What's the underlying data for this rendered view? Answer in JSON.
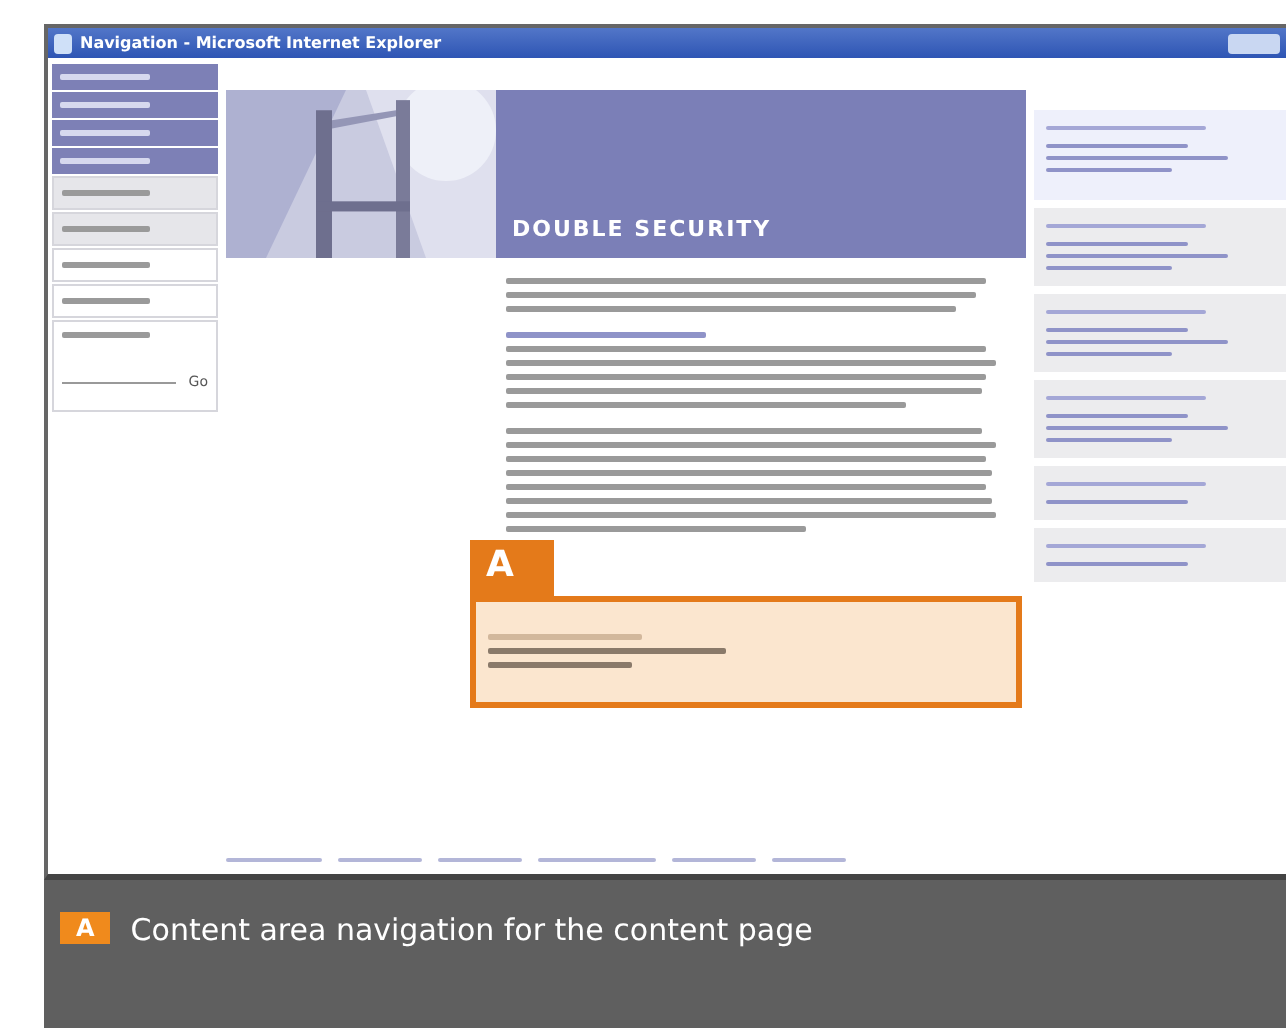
{
  "window": {
    "title": "Navigation - Microsoft Internet Explorer"
  },
  "sidebar": {
    "items": [
      {
        "kind": "accent"
      },
      {
        "kind": "accent"
      },
      {
        "kind": "accent"
      },
      {
        "kind": "accent"
      },
      {
        "kind": "shaded"
      },
      {
        "kind": "shaded"
      },
      {
        "kind": "plain"
      },
      {
        "kind": "plain"
      },
      {
        "kind": "search"
      }
    ],
    "go_button": "Go"
  },
  "banner": {
    "title": "DOUBLE SECURITY"
  },
  "content_callout": {
    "label": "A"
  },
  "right_panel": {
    "sections": [
      {
        "kind": "tinted"
      },
      {
        "kind": "plain"
      },
      {
        "kind": "plain"
      },
      {
        "kind": "plain"
      },
      {
        "kind": "plain"
      },
      {
        "kind": "plain"
      }
    ]
  },
  "caption": {
    "badge": "A",
    "text": "Content area navigation for the content page"
  }
}
